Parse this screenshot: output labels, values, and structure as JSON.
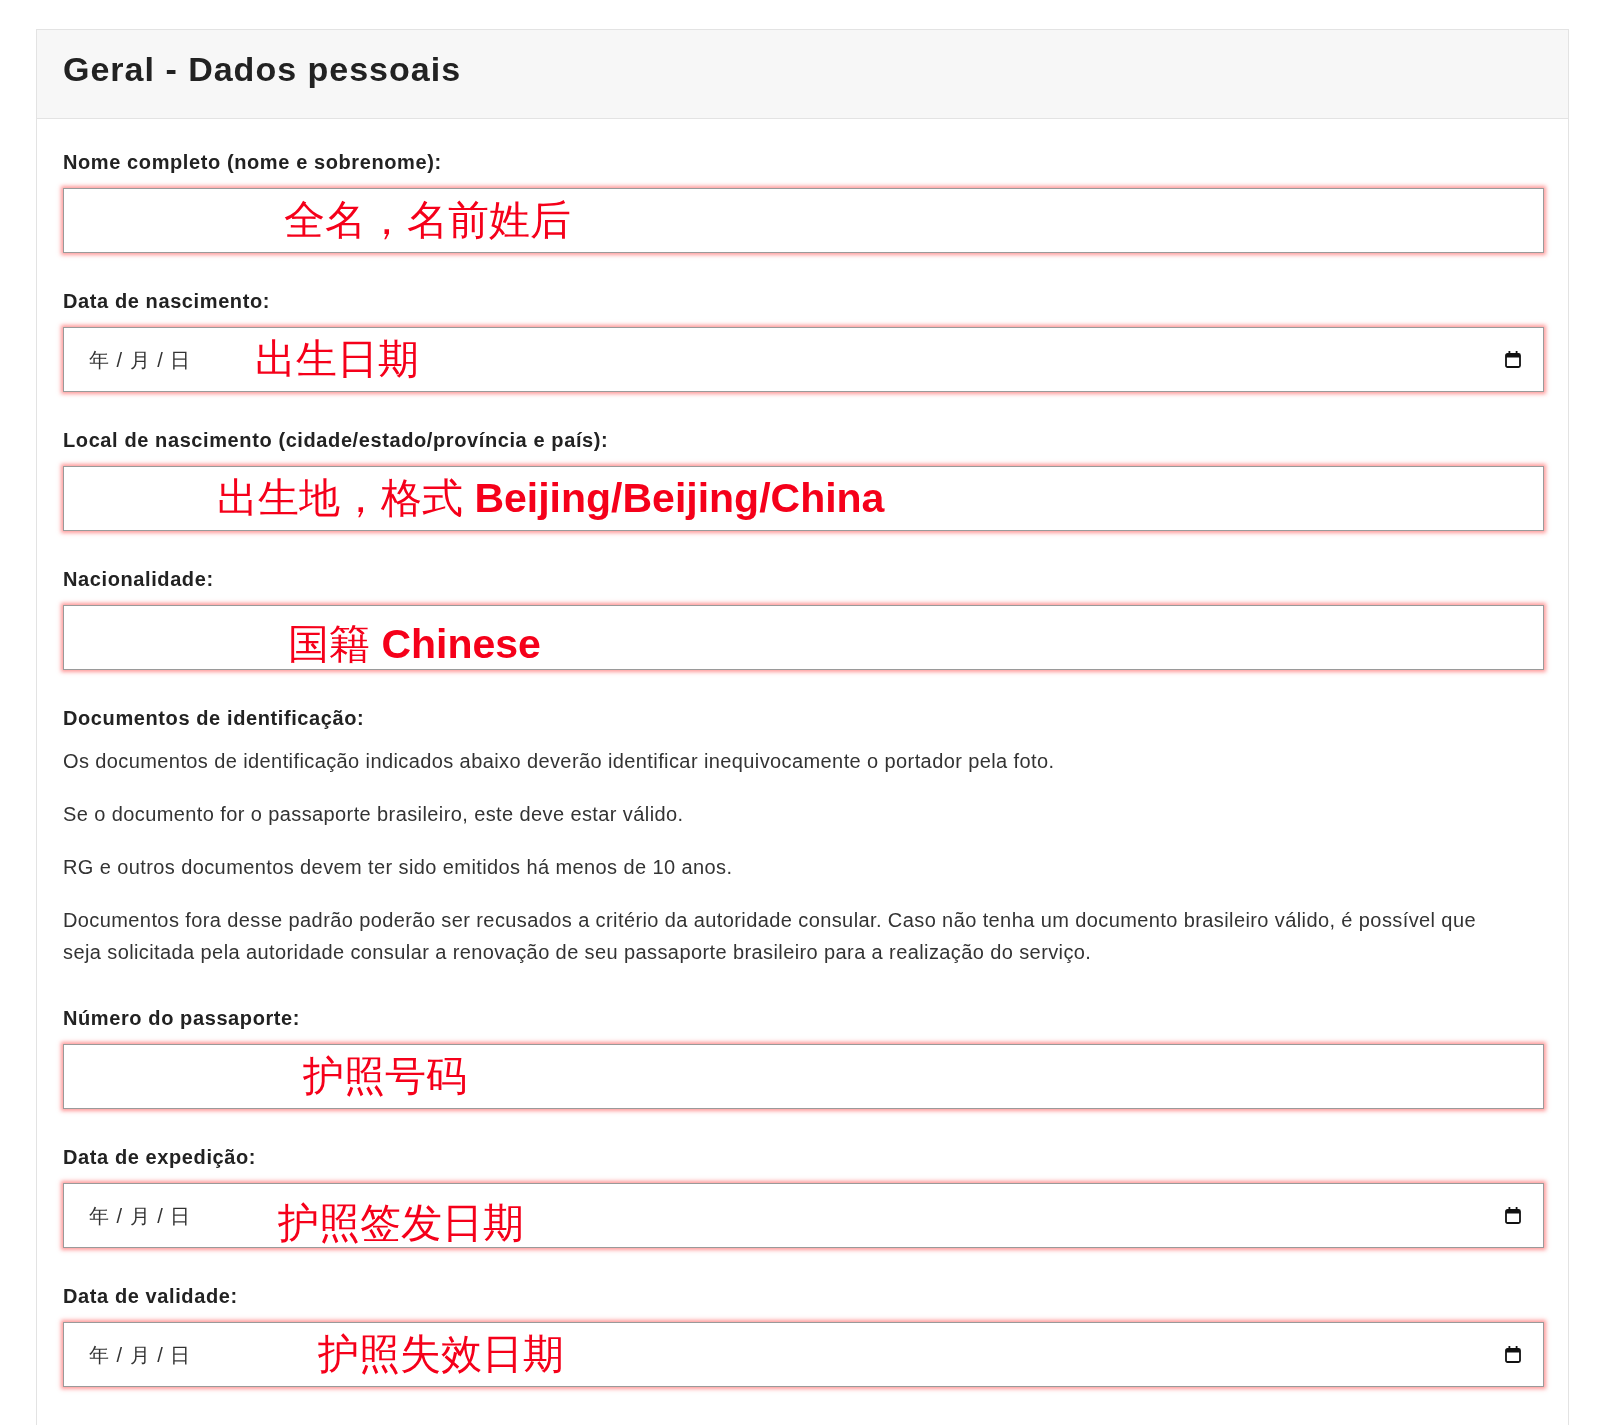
{
  "header": {
    "title": "Geral - Dados pessoais"
  },
  "personal_fields": [
    {
      "kind": "text",
      "label": "Nome completo (nome e sobrenome):",
      "annotation": "全名，名前姓后"
    },
    {
      "kind": "date",
      "label": "Data de nascimento:",
      "placeholder": "年 / 月 / 日",
      "annotation": "出生日期"
    },
    {
      "kind": "text",
      "label": "Local de nascimento (cidade/estado/província e país):",
      "annotation": "出生地，格式 **Beijing/Beijing/China**"
    },
    {
      "kind": "text",
      "label": "Nacionalidade:",
      "annotation": "国籍 **Chinese**"
    }
  ],
  "identification_documents": {
    "heading": "Documentos de identificação:",
    "paragraphs": [
      "Os documentos de identificação indicados abaixo deverão identificar inequivocamente o portador pela foto.",
      "Se o documento for o passaporte brasileiro, este deve estar válido.",
      "RG e outros documentos devem ter sido emitidos há menos de 10 anos.",
      "Documentos fora desse padrão poderão ser recusados a critério da autoridade consular. Caso não tenha um documento brasileiro válido, é possível que seja solicitada pela autoridade consular a renovação de seu passaporte brasileiro para a realização do serviço."
    ]
  },
  "passport_fields": [
    {
      "kind": "text",
      "label": "Número do passaporte:",
      "annotation": "护照号码"
    },
    {
      "kind": "date",
      "label": "Data de expedição:",
      "placeholder": "年 / 月 / 日",
      "annotation": "护照签发日期"
    },
    {
      "kind": "date",
      "label": "Data de validade:",
      "placeholder": "年 / 月 / 日",
      "annotation": "护照失效日期"
    }
  ]
}
